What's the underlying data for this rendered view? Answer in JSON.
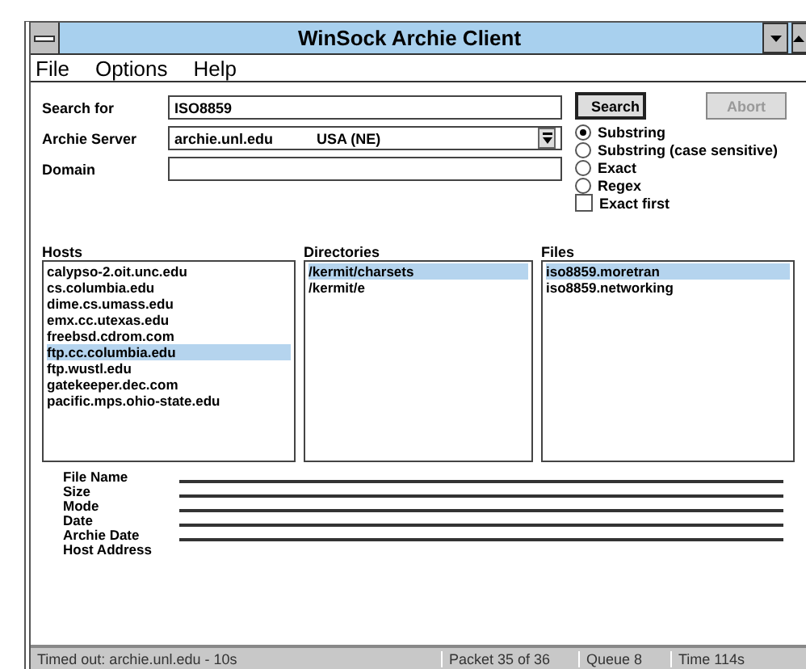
{
  "window": {
    "title": "WinSock Archie Client"
  },
  "menu": [
    "File",
    "Options",
    "Help"
  ],
  "search": {
    "label": "Search for",
    "value": "ISO8859"
  },
  "server": {
    "label": "Archie Server",
    "value": "archie.unl.edu",
    "region": "USA (NE)"
  },
  "domain": {
    "label": "Domain"
  },
  "buttons": [
    {
      "label": "Search",
      "disabled": false
    },
    {
      "label": "Abort",
      "disabled": true
    }
  ],
  "match_options": [
    {
      "label": "Substring",
      "selected": true
    },
    {
      "label": "Substring (case sensitive)",
      "selected": false
    },
    {
      "label": "Exact",
      "selected": false
    },
    {
      "label": "Regex",
      "selected": false
    }
  ],
  "exact_first": {
    "label": "Exact first",
    "checked": false
  },
  "lists": [
    {
      "title": "Hosts",
      "items": [
        {
          "text": "calypso-2.oit.unc.edu",
          "selected": false
        },
        {
          "text": "cs.columbia.edu",
          "selected": false
        },
        {
          "text": "dime.cs.umass.edu",
          "selected": false
        },
        {
          "text": "emx.cc.utexas.edu",
          "selected": false
        },
        {
          "text": "freebsd.cdrom.com",
          "selected": false
        },
        {
          "text": "ftp.cc.columbia.edu",
          "selected": true
        },
        {
          "text": "ftp.wustl.edu",
          "selected": false
        },
        {
          "text": "gatekeeper.dec.com",
          "selected": false
        },
        {
          "text": "pacific.mps.ohio-state.edu",
          "selected": false
        }
      ]
    },
    {
      "title": "Directories",
      "items": [
        {
          "text": "/kermit/charsets",
          "selected": true
        },
        {
          "text": "/kermit/e",
          "selected": false
        }
      ]
    },
    {
      "title": "Files",
      "items": [
        {
          "text": "iso8859.moretran",
          "selected": true
        },
        {
          "text": "iso8859.networking",
          "selected": false
        }
      ]
    }
  ],
  "details": [
    "File Name",
    "Size",
    "Mode",
    "Date",
    "Archie Date",
    "Host Address"
  ],
  "status_bar": [
    "Timed out: archie.unl.edu - 10s",
    "Packet 35 of 36",
    "Queue 8",
    "Time 114s"
  ]
}
